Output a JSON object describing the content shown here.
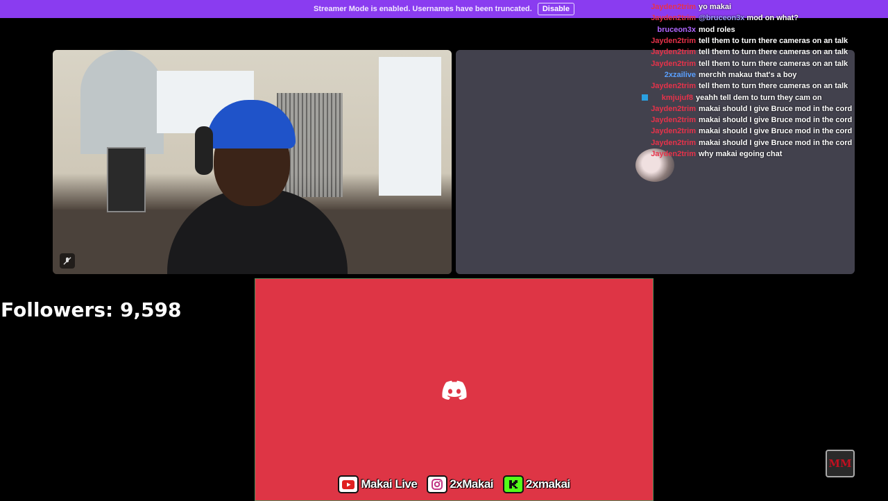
{
  "banner": {
    "message": "Streamer Mode is enabled. Usernames have been truncated.",
    "disable_label": "Disable"
  },
  "followers": {
    "text": "Followers: 9,598"
  },
  "chat": [
    {
      "user": "Jayden2trim",
      "color": "#e8324a",
      "text": "yo makai"
    },
    {
      "user": "Jayden2trim",
      "color": "#e8324a",
      "mention": "@bruceon3x",
      "text": "mod on what?"
    },
    {
      "user": "bruceon3x",
      "color": "#b066ff",
      "text": "mod roles"
    },
    {
      "user": "Jayden2trim",
      "color": "#e8324a",
      "text": "tell them to turn there cameras on an talk"
    },
    {
      "user": "Jayden2trim",
      "color": "#e8324a",
      "text": "tell them to turn there cameras on an talk"
    },
    {
      "user": "Jayden2trim",
      "color": "#e8324a",
      "text": "tell them to turn there cameras on an talk"
    },
    {
      "user": "2xzailive",
      "color": "#5aa0ff",
      "text": "merchh makau that's a boy"
    },
    {
      "user": "Jayden2trim",
      "color": "#e8324a",
      "text": "tell them to turn there cameras on an talk"
    },
    {
      "user": "kmjujuf8",
      "color": "#e8324a",
      "badge": true,
      "text": "yeahh tell dem to turn they cam on"
    },
    {
      "user": "Jayden2trim",
      "color": "#e8324a",
      "text": "makai should I give Bruce mod in the cord"
    },
    {
      "user": "Jayden2trim",
      "color": "#e8324a",
      "text": "makai should I give Bruce mod in the cord"
    },
    {
      "user": "Jayden2trim",
      "color": "#e8324a",
      "text": "makai should I give Bruce mod in the cord"
    },
    {
      "user": "Jayden2trim",
      "color": "#e8324a",
      "text": "makai should I give Bruce mod in the cord"
    },
    {
      "user": "Jayden2trim",
      "color": "#e8324a",
      "text": "why makai egoing chat"
    }
  ],
  "socials": [
    {
      "platform": "youtube",
      "icon": "youtube-icon",
      "handle": "Makai Live",
      "color": "#e02020"
    },
    {
      "platform": "instagram",
      "icon": "instagram-icon",
      "handle": "2xMakai",
      "color": "#c13584"
    },
    {
      "platform": "kick",
      "icon": "kick-icon",
      "handle": "2xmakai",
      "color": "#53fc18"
    }
  ],
  "colors": {
    "discord_panel": "#de3545",
    "banner": "#8a3cf0",
    "empty_tile": "#42414d"
  },
  "logo": {
    "text": "MM"
  }
}
